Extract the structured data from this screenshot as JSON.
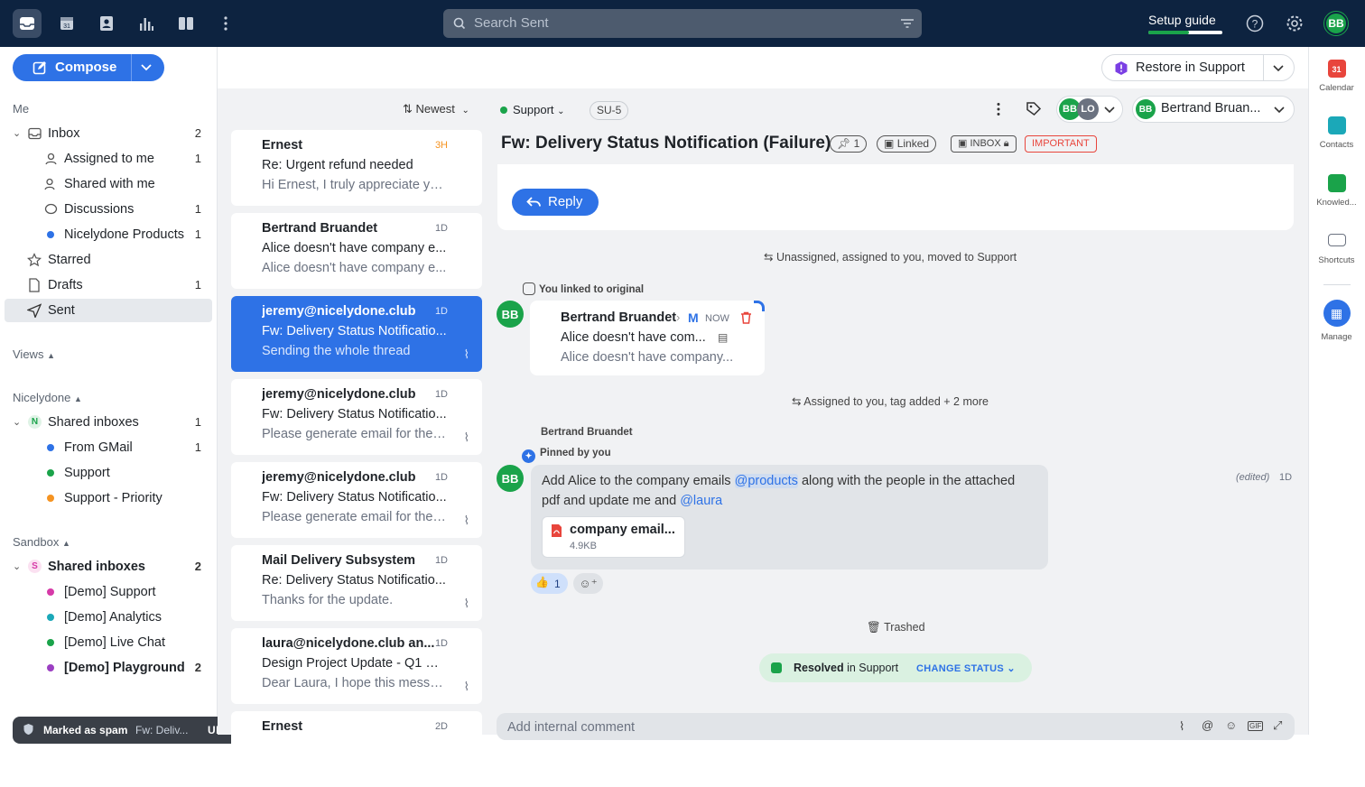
{
  "topbar": {
    "search_placeholder": "Search Sent",
    "setup_label": "Setup guide",
    "setup_progress": 0.55,
    "user_initials": "BB",
    "icons": [
      "inbox-icon",
      "calendar-icon",
      "contacts-icon",
      "analytics-icon",
      "columns-icon",
      "more-icon"
    ]
  },
  "compose": {
    "label": "Compose"
  },
  "sidebar": {
    "me_label": "Me",
    "inbox": {
      "label": "Inbox",
      "count": "2"
    },
    "assigned": {
      "label": "Assigned to me",
      "count": "1"
    },
    "shared": {
      "label": "Shared with me"
    },
    "discussions": {
      "label": "Discussions",
      "count": "1"
    },
    "nicelydone_products": {
      "label": "Nicelydone Products",
      "count": "1",
      "color": "#2e72e6"
    },
    "starred": {
      "label": "Starred"
    },
    "drafts": {
      "label": "Drafts",
      "count": "1"
    },
    "sent": {
      "label": "Sent"
    },
    "views_label": "Views",
    "nicelydone_label": "Nicelydone",
    "shared_inboxes_1": {
      "label": "Shared inboxes",
      "count": "1",
      "badge": "N"
    },
    "from_gmail": {
      "label": "From GMail",
      "count": "1",
      "color": "#2e72e6"
    },
    "support": {
      "label": "Support",
      "color": "#1aa34a"
    },
    "support_priority": {
      "label": "Support - Priority",
      "color": "#f59321"
    },
    "sandbox_label": "Sandbox",
    "shared_inboxes_2": {
      "label": "Shared inboxes",
      "count": "2",
      "badge": "S"
    },
    "demo_support": {
      "label": "[Demo] Support",
      "color": "#d63aa8"
    },
    "demo_analytics": {
      "label": "[Demo] Analytics",
      "color": "#1ba8b8"
    },
    "demo_livechat": {
      "label": "[Demo] Live Chat",
      "color": "#1aa34a"
    },
    "demo_playground": {
      "label": "[Demo] Playground",
      "count": "2",
      "color": "#9b3fc2"
    }
  },
  "toast": {
    "title": "Marked as spam",
    "subject": "Fw: Deliv...",
    "action": "UNDO"
  },
  "list": {
    "sort_label": "Newest",
    "items": [
      {
        "from": "Ernest",
        "subject": "Re: Urgent refund needed",
        "preview": "Hi Ernest, I truly appreciate yo...",
        "time": "3H"
      },
      {
        "from": "Bertrand Bruandet",
        "subject": "Alice doesn't have company e...",
        "preview": "Alice doesn't have company e...",
        "time": "1D"
      },
      {
        "from": "jeremy@nicelydone.club",
        "subject": "Fw: Delivery Status Notificatio...",
        "preview": "Sending the whole thread",
        "time": "1D"
      },
      {
        "from": "jeremy@nicelydone.club",
        "subject": "Fw: Delivery Status Notificatio...",
        "preview": "Please generate email for the ...",
        "time": "1D"
      },
      {
        "from": "jeremy@nicelydone.club",
        "subject": "Fw: Delivery Status Notificatio...",
        "preview": "Please generate email for the ...",
        "time": "1D"
      },
      {
        "from": "Mail Delivery Subsystem",
        "subject": "Re: Delivery Status Notificatio...",
        "preview": "Thanks for the update.",
        "time": "1D"
      },
      {
        "from": "laura@nicelydone.club an...",
        "subject": "Design Project Update - Q1 W...",
        "preview": "Dear Laura, I hope this messa...",
        "time": "1D"
      },
      {
        "from": "Ernest",
        "subject": "",
        "preview": "",
        "time": "2D"
      }
    ]
  },
  "header": {
    "restore_label": "Restore in Support",
    "inbox_tag": "Support",
    "ticket_id": "SU-5",
    "assignee_name": "Bertrand Bruan...",
    "assignee_initials": "BB",
    "participant_initials_1": "BB",
    "participant_initials_2": "LO"
  },
  "conversation": {
    "title": "Fw: Delivery Status Notification (Failure)",
    "pin_count": "1",
    "linked_label": "Linked",
    "inbox_label": "INBOX",
    "important_label": "IMPORTANT",
    "reply_label": "Reply",
    "event1": "Unassigned, assigned to you, moved to Support",
    "linked_note": "You linked to original",
    "linked_msg": {
      "from": "Bertrand Bruandet",
      "via": "M",
      "time": "NOW",
      "subject": "Alice doesn't have com...",
      "preview": "Alice doesn't have company...",
      "initials": "BB"
    },
    "event2": "Assigned to you, tag added + 2 more",
    "comment": {
      "author": "Bertrand Bruandet",
      "pinned": "Pinned by you",
      "initials": "BB",
      "text_a": "Add Alice to the company emails ",
      "mention1": "@products",
      "text_b": " along with the people in the attached",
      "text_c": "pdf and update me and ",
      "mention2": "@laura",
      "edited": "(edited)",
      "time": "1D",
      "attachment_name": "company email...",
      "attachment_size": "4.9KB",
      "reaction_count": "1"
    },
    "trashed_label": "Trashed",
    "status": {
      "resolved": "Resolved",
      "in": "in Support",
      "change": "CHANGE STATUS"
    },
    "comment_placeholder": "Add internal comment"
  },
  "right_apps": [
    {
      "label": "Calendar",
      "color": "#e8453c"
    },
    {
      "label": "Contacts",
      "color": "#1ba8b8"
    },
    {
      "label": "Knowled...",
      "color": "#1aa34a"
    },
    {
      "label": "Shortcuts",
      "color": "#6b7280"
    },
    {
      "label": "Manage",
      "color": "#2e72e6"
    }
  ]
}
